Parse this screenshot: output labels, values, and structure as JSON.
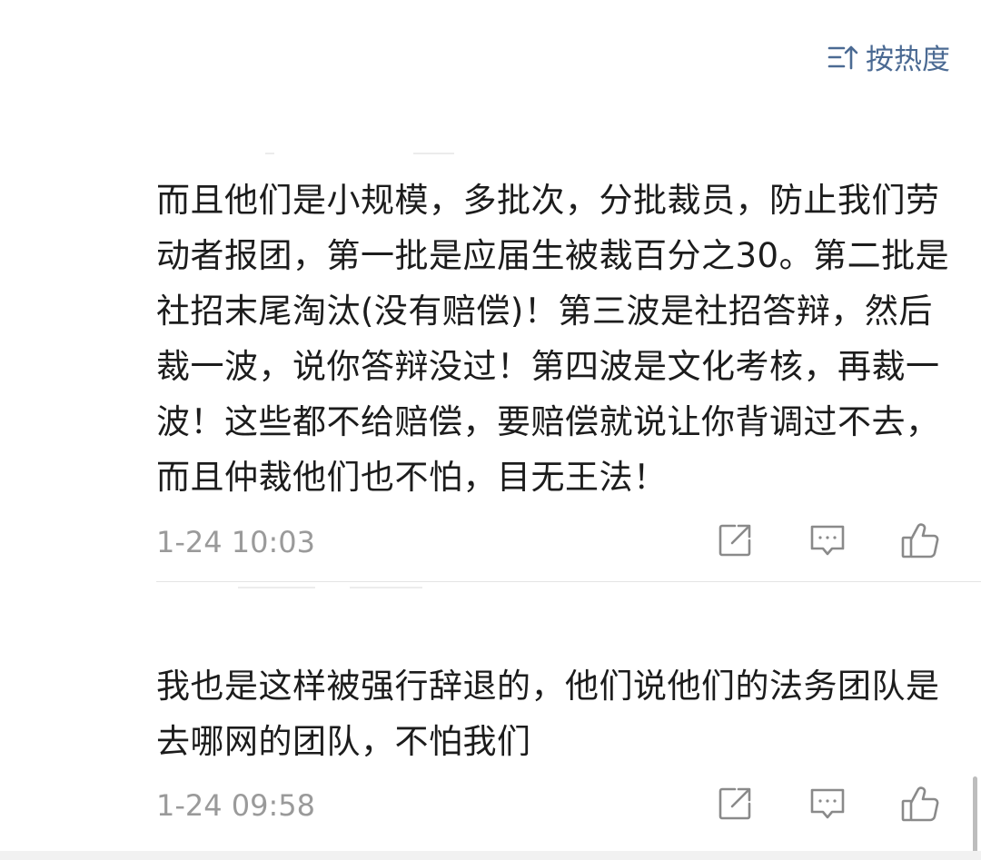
{
  "sort": {
    "label": "按热度",
    "icon": "sort-icon"
  },
  "colors": {
    "accent": "#4b6a93",
    "text": "#1c1c1c",
    "meta": "#9a9a9a",
    "icon": "#8a8a8a"
  },
  "comments": [
    {
      "text": "而且他们是小规模，多批次，分批裁员，防止我们劳动者报团，第一批是应届生被裁百分之30。第二批是社招末尾淘汰(没有赔偿)！第三波是社招答辩，然后裁一波，说你答辩没过！第四波是文化考核，再裁一波！这些都不给赔偿，要赔偿就说让你背调过不去，而且仲裁他们也不怕，目无王法！",
      "time": "1-24 10:03",
      "actions": [
        "share-icon",
        "reply-icon",
        "like-icon"
      ]
    },
    {
      "text": "我也是这样被强行辞退的，他们说他们的法务团队是去哪网的团队，不怕我们",
      "time": "1-24 09:58",
      "actions": [
        "share-icon",
        "reply-icon",
        "like-icon"
      ]
    }
  ]
}
